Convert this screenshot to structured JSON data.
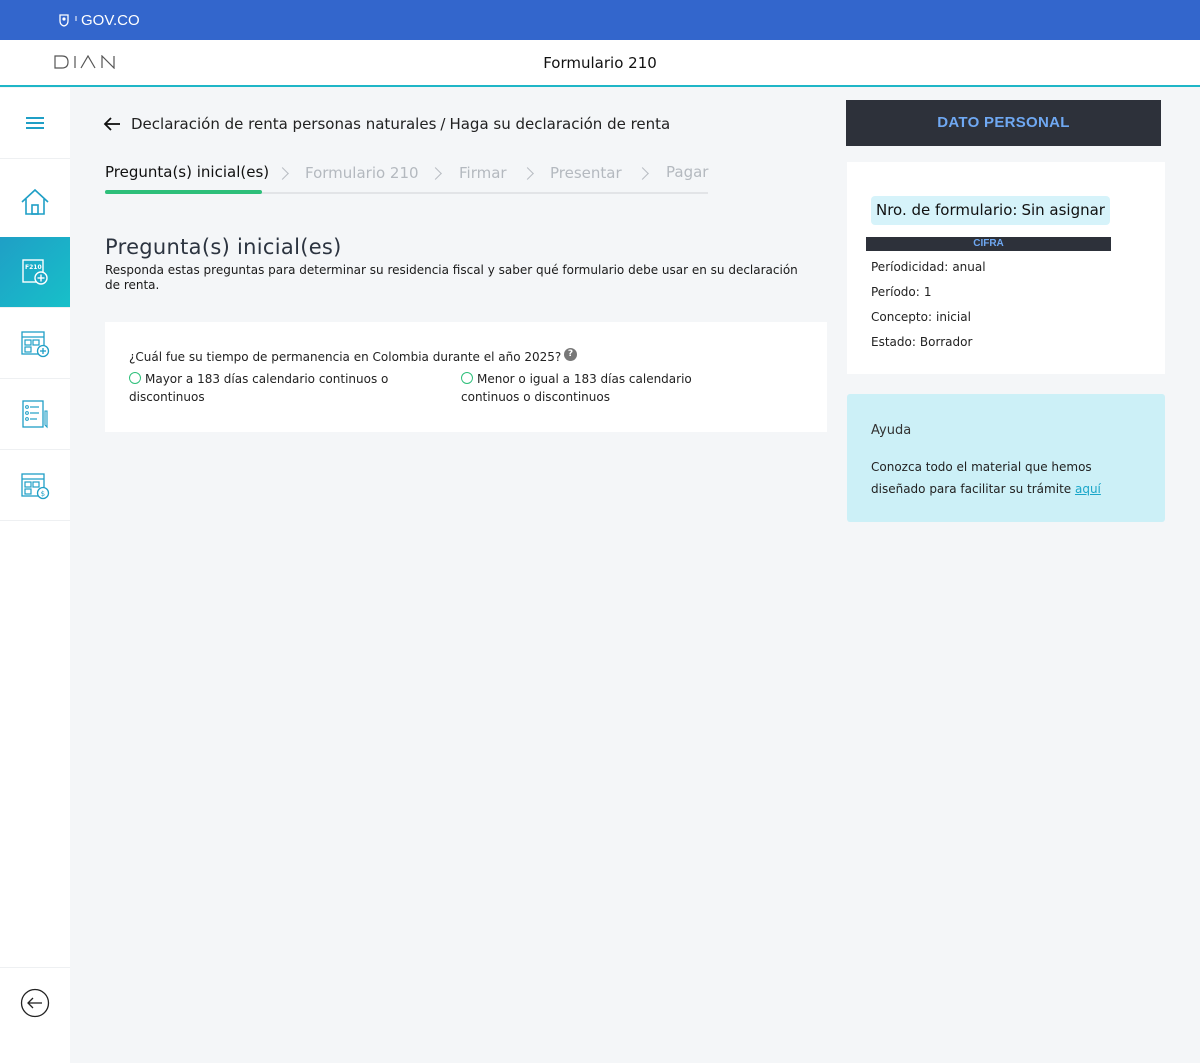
{
  "gov_bar": {
    "logo_text": "GOV.CO",
    "color": "#3366cc"
  },
  "header": {
    "logo_text": "DIAN",
    "title": "Formulario 210",
    "accent": "#1fb6c7"
  },
  "sidebar": {
    "items": [
      {
        "icon": "menu-icon"
      },
      {
        "icon": "home-icon"
      },
      {
        "icon": "form-210-add-icon",
        "label": "F210",
        "active": true
      },
      {
        "icon": "calendar-add-icon"
      },
      {
        "icon": "checklist-icon"
      },
      {
        "icon": "calendar-payment-icon"
      }
    ],
    "back_icon": "arrow-left-circle-icon",
    "active_color": "#1f9fc6"
  },
  "breadcrumb": {
    "parent": "Declaración de renta personas naturales",
    "separator": "/",
    "current": "Haga su declaración de renta"
  },
  "steps": [
    {
      "label": "Pregunta(s) inicial(es)",
      "active": true
    },
    {
      "label": "Formulario 210",
      "active": false
    },
    {
      "label": "Firmar",
      "active": false
    },
    {
      "label": "Presentar",
      "active": false
    },
    {
      "label": "Pagar",
      "active": false
    }
  ],
  "main": {
    "title": "Pregunta(s) inicial(es)",
    "description": "Responda estas preguntas para determinar su residencia fiscal y saber qué formulario debe usar en su declaración de renta."
  },
  "question": {
    "text": "¿Cuál fue su tiempo de permanencia en Colombia durante el año 2025?",
    "help_icon": "?",
    "options": [
      "Mayor a 183 días calendario continuos o discontinuos",
      "Menor o igual a 183 días calendario continuos o discontinuos"
    ],
    "selected": null,
    "accent": "#2dbf7a"
  },
  "panel": {
    "button_label": "DATO PERSONAL",
    "form_number_label": "Nro. de formulario:",
    "form_number_value": "Sin asignar",
    "cifra_label": "CIFRA",
    "rows": [
      {
        "label": "Períodicidad:",
        "value": "anual"
      },
      {
        "label": "Período:",
        "value": "1"
      },
      {
        "label": "Concepto:",
        "value": "inicial"
      },
      {
        "label": "Estado:",
        "value": "Borrador"
      }
    ]
  },
  "help": {
    "title": "Ayuda",
    "text": "Conozca todo el material que hemos diseñado para facilitar su trámite ",
    "link": "aquí",
    "background": "#ccf0f7"
  }
}
